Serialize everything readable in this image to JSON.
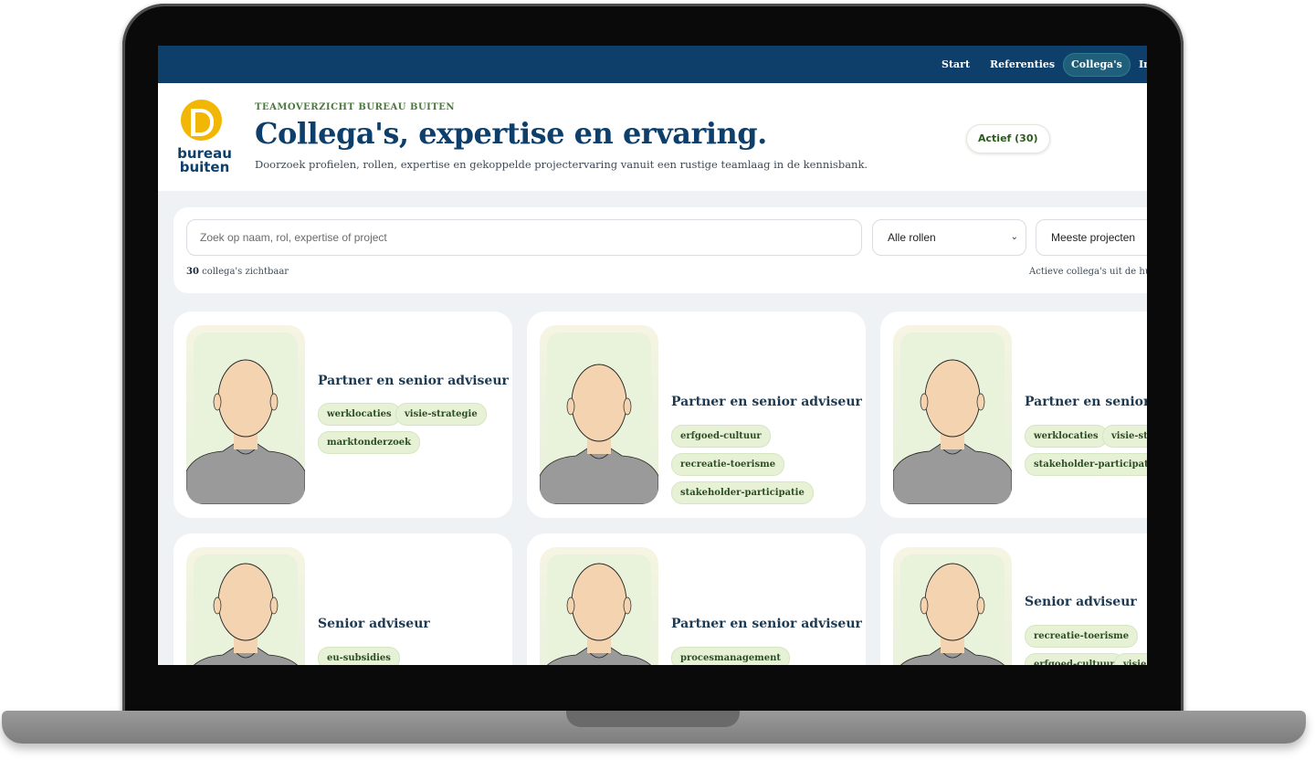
{
  "nav": {
    "items": [
      "Start",
      "Referenties",
      "Collega's",
      "In"
    ],
    "active": "Collega's"
  },
  "header": {
    "logo_text": "bureau buiten",
    "eyebrow": "TEAMOVERZICHT BUREAU BUITEN",
    "title": "Collega's, expertise en ervaring.",
    "subtitle": "Doorzoek profielen, rollen, expertise en gekoppelde projectervaring vanuit een rustige teamlaag in de kennisbank.",
    "active_badge": "Actief (30)"
  },
  "filters": {
    "search_placeholder": "Zoek op naam, rol, expertise of project",
    "role_select": "Alle rollen",
    "sort_select": "Meeste projecten",
    "count_number": "30",
    "count_text": " collega's zichtbaar",
    "active_note": "Actieve collega's uit de hui"
  },
  "cards": [
    {
      "role": "Partner en senior adviseur",
      "tags": [
        "werklocaties",
        "visie-strategie",
        "marktonderzoek"
      ]
    },
    {
      "role": "Partner en senior adviseur",
      "tags": [
        "erfgoed-cultuur",
        "recreatie-toerisme",
        "stakeholder-participatie"
      ]
    },
    {
      "role": "Partner en senior a",
      "tags": [
        "werklocaties",
        "visie-str",
        "stakeholder-participatie"
      ]
    },
    {
      "role": "Senior adviseur",
      "tags": [
        "eu-subsidies"
      ]
    },
    {
      "role": "Partner en senior adviseur",
      "tags": [
        "procesmanagement"
      ]
    },
    {
      "role": "Senior adviseur",
      "tags": [
        "recreatie-toerisme",
        "erfgoed-cultuur",
        "visie"
      ]
    }
  ],
  "colors": {
    "nav_bg": "#0e3f6b",
    "title": "#0e3f6b",
    "accent_green": "#4a7a3d",
    "logo_yellow": "#f2b705",
    "tag_bg": "#e7f1d6"
  }
}
